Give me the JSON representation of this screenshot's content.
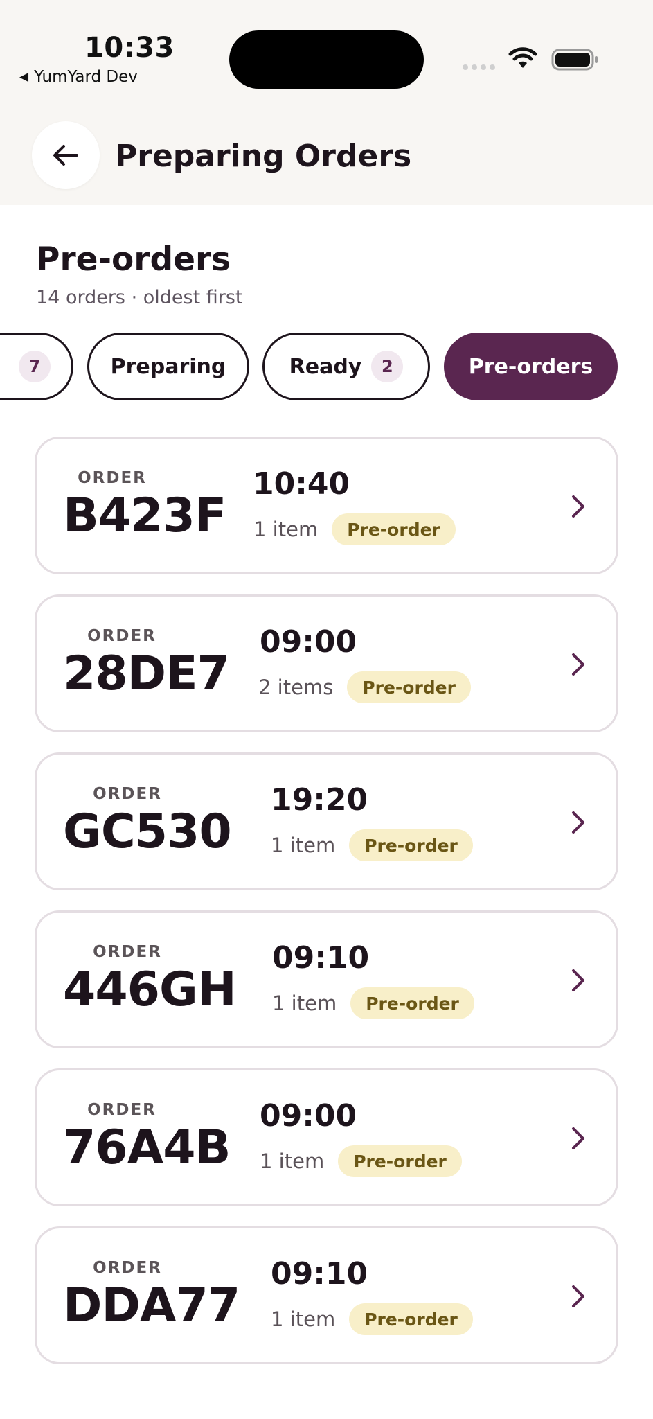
{
  "status_bar": {
    "time": "10:33",
    "back_app": "YumYard Dev"
  },
  "nav": {
    "title": "Preparing Orders",
    "back_icon": "arrow-left-icon"
  },
  "section": {
    "title": "Pre-orders",
    "subtitle": "14 orders · oldest first"
  },
  "filters": [
    {
      "label": "",
      "count": "7",
      "active": false
    },
    {
      "label": "Preparing",
      "count": "",
      "active": false
    },
    {
      "label": "Ready",
      "count": "2",
      "active": false
    },
    {
      "label": "Pre-orders",
      "count": "",
      "active": true
    }
  ],
  "order_label": "ORDER",
  "orders": [
    {
      "code": "B423F",
      "time": "10:40",
      "items": "1 item",
      "badge": "Pre-order"
    },
    {
      "code": "28DE7",
      "time": "09:00",
      "items": "2 items",
      "badge": "Pre-order"
    },
    {
      "code": "GC530",
      "time": "19:20",
      "items": "1 item",
      "badge": "Pre-order"
    },
    {
      "code": "446GH",
      "time": "09:10",
      "items": "1 item",
      "badge": "Pre-order"
    },
    {
      "code": "76A4B",
      "time": "09:00",
      "items": "1 item",
      "badge": "Pre-order"
    },
    {
      "code": "DDA77",
      "time": "09:10",
      "items": "1 item",
      "badge": "Pre-order"
    }
  ],
  "colors": {
    "accent": "#5a2650",
    "badge_bg": "#f8efc9",
    "badge_text": "#6a5615",
    "header_bg": "#f8f6f3"
  }
}
